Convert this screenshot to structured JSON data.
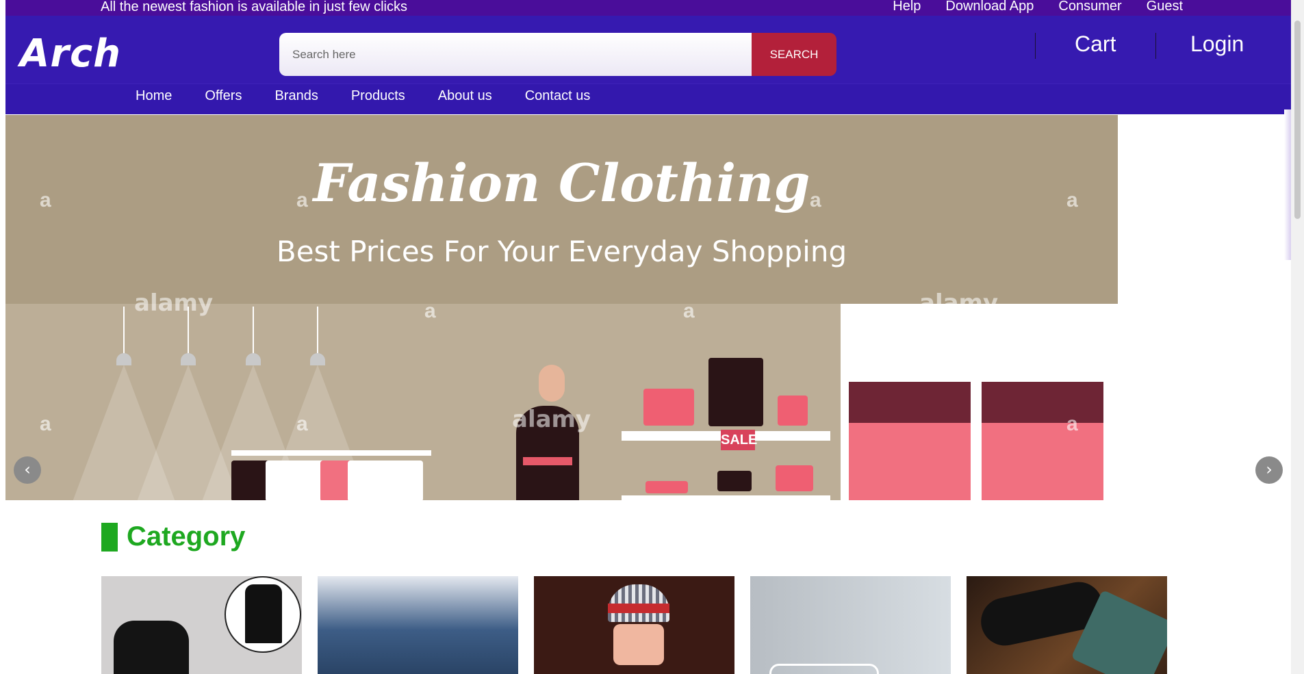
{
  "top_strip": {
    "tagline": "All the newest fashion is available in just few clicks",
    "links": [
      "Help",
      "Download App",
      "Consumer",
      "Guest"
    ]
  },
  "header": {
    "logo": "Arch",
    "search_placeholder": "Search here",
    "search_button": "SEARCH",
    "cart_label": "Cart",
    "login_label": "Login"
  },
  "nav": {
    "items": [
      "Home",
      "Offers",
      "Brands",
      "Products",
      "About us",
      "Contact us"
    ]
  },
  "banner": {
    "title": "Fashion Clothing",
    "subtitle": "Best Prices For Your Everyday Shopping",
    "watermark": "alamy",
    "watermark_letter": "a",
    "sale_tag": "SALE",
    "prev_arrow": "‹",
    "next_arrow": "›"
  },
  "category": {
    "title": "Category",
    "cards": [
      "shirt",
      "jeans",
      "kids hat",
      "hangers",
      "shoes and tie"
    ]
  },
  "colors": {
    "top_strip": "#4a0d9a",
    "header": "#361ab0",
    "search_button": "#b3203a",
    "category_green": "#1ea820"
  }
}
